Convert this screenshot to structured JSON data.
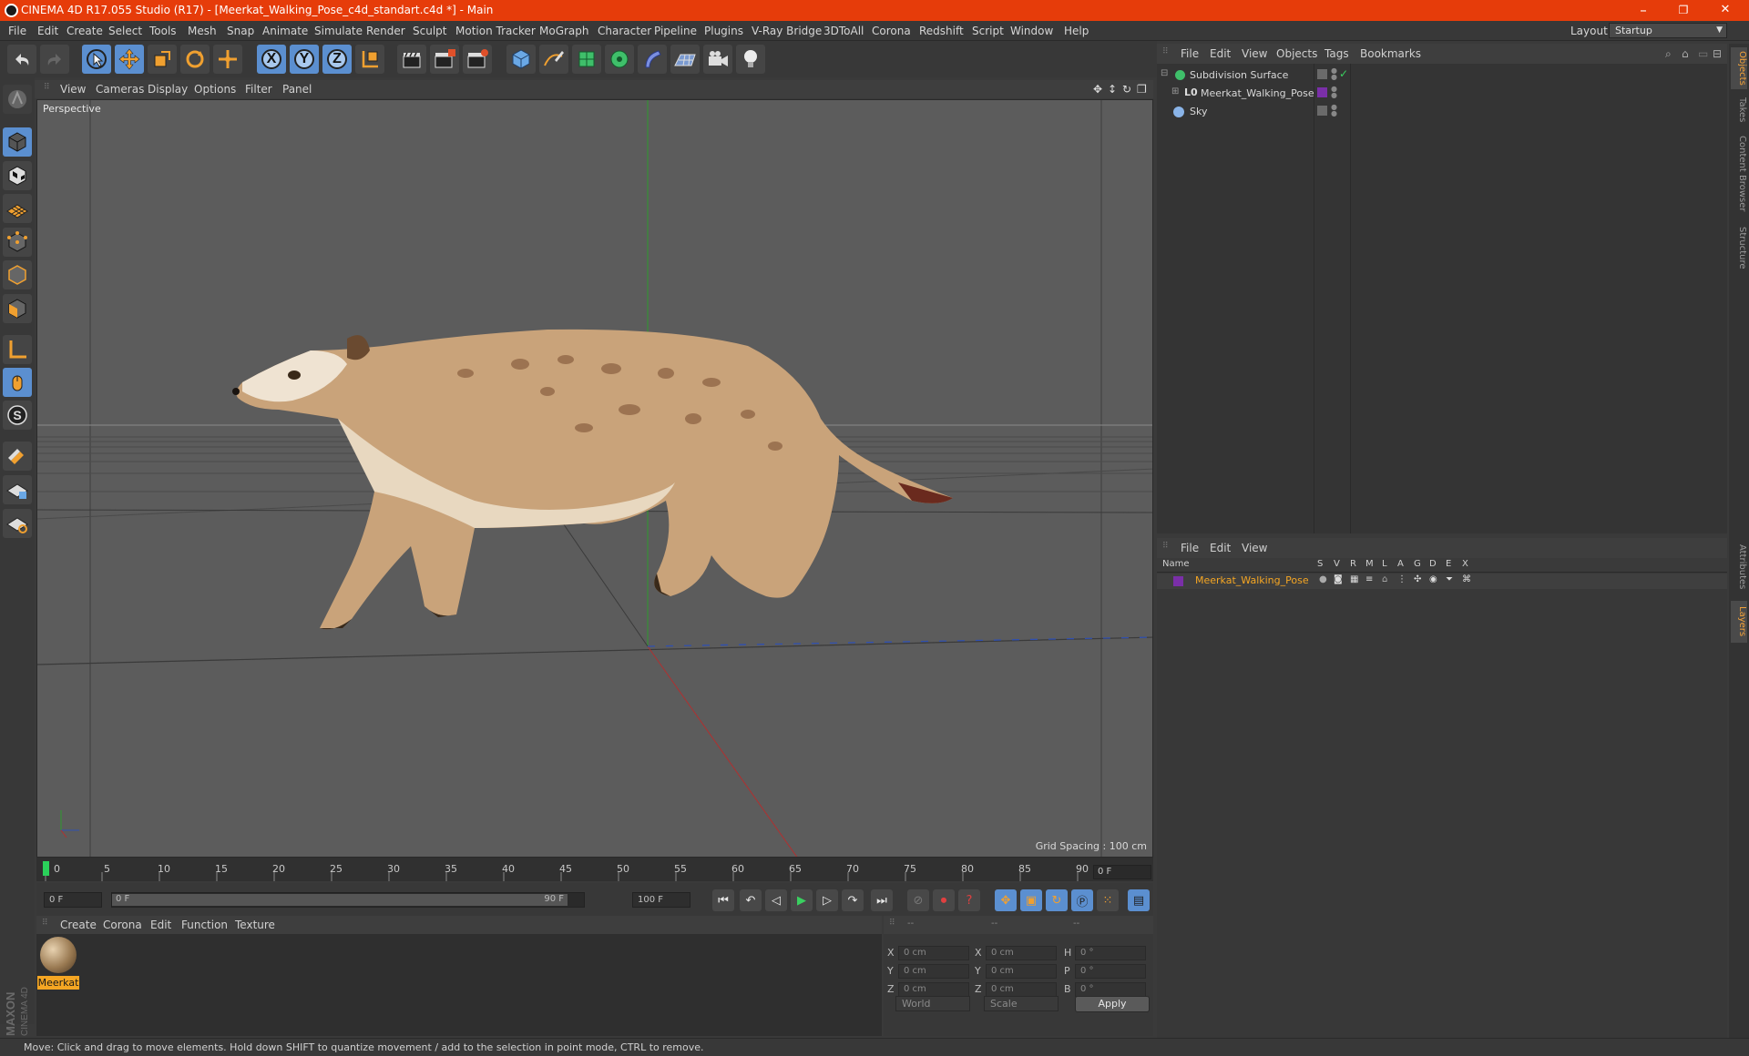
{
  "window": {
    "title": "CINEMA 4D R17.055 Studio (R17) - [Meerkat_Walking_Pose_c4d_standart.c4d *] - Main",
    "minimize": "–",
    "restore": "❐",
    "close": "✕"
  },
  "menubar": {
    "items": [
      "File",
      "Edit",
      "Create",
      "Select",
      "Tools",
      "Mesh",
      "Snap",
      "Animate",
      "Simulate",
      "Render",
      "Sculpt",
      "Motion Tracker",
      "MoGraph",
      "Character",
      "Pipeline",
      "Plugins",
      "V-Ray Bridge",
      "3DToAll",
      "Corona",
      "Redshift",
      "Script",
      "Window",
      "Help"
    ],
    "layout_label": "Layout:",
    "layout_value": "Startup"
  },
  "viewport": {
    "menu": [
      "View",
      "Cameras",
      "Display",
      "Options",
      "Filter",
      "Panel"
    ],
    "camera_label": "Perspective",
    "grid_spacing": "Grid Spacing : 100 cm"
  },
  "timeline": {
    "ticks": [
      "0",
      "5",
      "10",
      "15",
      "20",
      "25",
      "30",
      "35",
      "40",
      "45",
      "50",
      "55",
      "60",
      "65",
      "70",
      "75",
      "80",
      "85",
      "90"
    ],
    "current_frame": "0 F",
    "start_field": "0 F",
    "range_start": "0 F",
    "range_end": "90 F",
    "end_field": "100 F"
  },
  "material_manager": {
    "menu": [
      "Create",
      "Corona",
      "Edit",
      "Function",
      "Texture"
    ],
    "materials": [
      {
        "name": "Meerkat"
      }
    ]
  },
  "coordinates": {
    "headers": [
      "--",
      "--",
      "--"
    ],
    "rows": [
      {
        "a": "X",
        "av": "0 cm",
        "b": "X",
        "bv": "0 cm",
        "c": "H",
        "cv": "0 °"
      },
      {
        "a": "Y",
        "av": "0 cm",
        "b": "Y",
        "bv": "0 cm",
        "c": "P",
        "cv": "0 °"
      },
      {
        "a": "Z",
        "av": "0 cm",
        "b": "Z",
        "bv": "0 cm",
        "c": "B",
        "cv": "0 °"
      }
    ],
    "mode": "World",
    "transform": "Scale",
    "apply": "Apply"
  },
  "status_bar": "Move: Click and drag to move elements. Hold down SHIFT to quantize movement / add to the selection in point mode, CTRL to remove.",
  "object_manager": {
    "menu": [
      "File",
      "Edit",
      "View",
      "Objects",
      "Tags",
      "Bookmarks"
    ],
    "objects": [
      {
        "name": "Subdivision Surface"
      },
      {
        "name": "Meerkat_Walking_Pose"
      },
      {
        "name": "Sky"
      }
    ]
  },
  "layer_manager": {
    "menu": [
      "File",
      "Edit",
      "View"
    ],
    "columns": [
      "Name",
      "S",
      "V",
      "R",
      "M",
      "L",
      "A",
      "G",
      "D",
      "E",
      "X"
    ],
    "layers": [
      {
        "name": "Meerkat_Walking_Pose",
        "color": "#7a2fa8"
      }
    ]
  },
  "right_tabs": [
    "Objects",
    "Takes",
    "Content Browser",
    "Structure",
    "Attributes",
    "Layers"
  ],
  "colors": {
    "accent": "#e63c0a",
    "selection_blue": "#5b8fd0",
    "highlight_orange": "#f5a623",
    "layer_purple": "#7a2fa8"
  }
}
